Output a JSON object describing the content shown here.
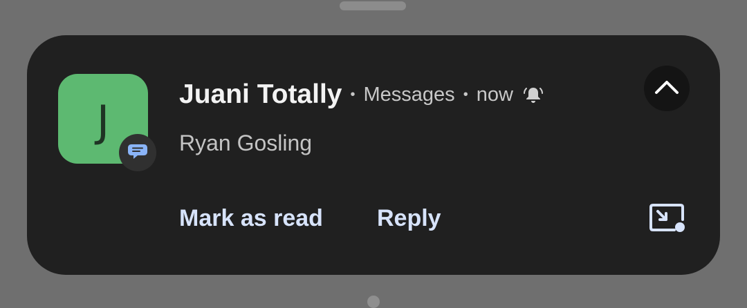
{
  "notification": {
    "avatar_letter": "J",
    "sender": "Juani Totally",
    "separator": "•",
    "app_name": "Messages",
    "timestamp": "now",
    "message": "Ryan Gosling",
    "actions": {
      "mark_read": "Mark as read",
      "reply": "Reply"
    }
  },
  "icons": {
    "app_badge": "messages-icon",
    "alert": "bell-alert-icon",
    "expand": "chevron-up-icon",
    "pip": "picture-in-picture-icon"
  },
  "colors": {
    "background": "#6f6f6f",
    "card": "#202020",
    "avatar": "#5db971",
    "action_text": "#d7e3fb",
    "badge_icon": "#8ab4f8"
  }
}
